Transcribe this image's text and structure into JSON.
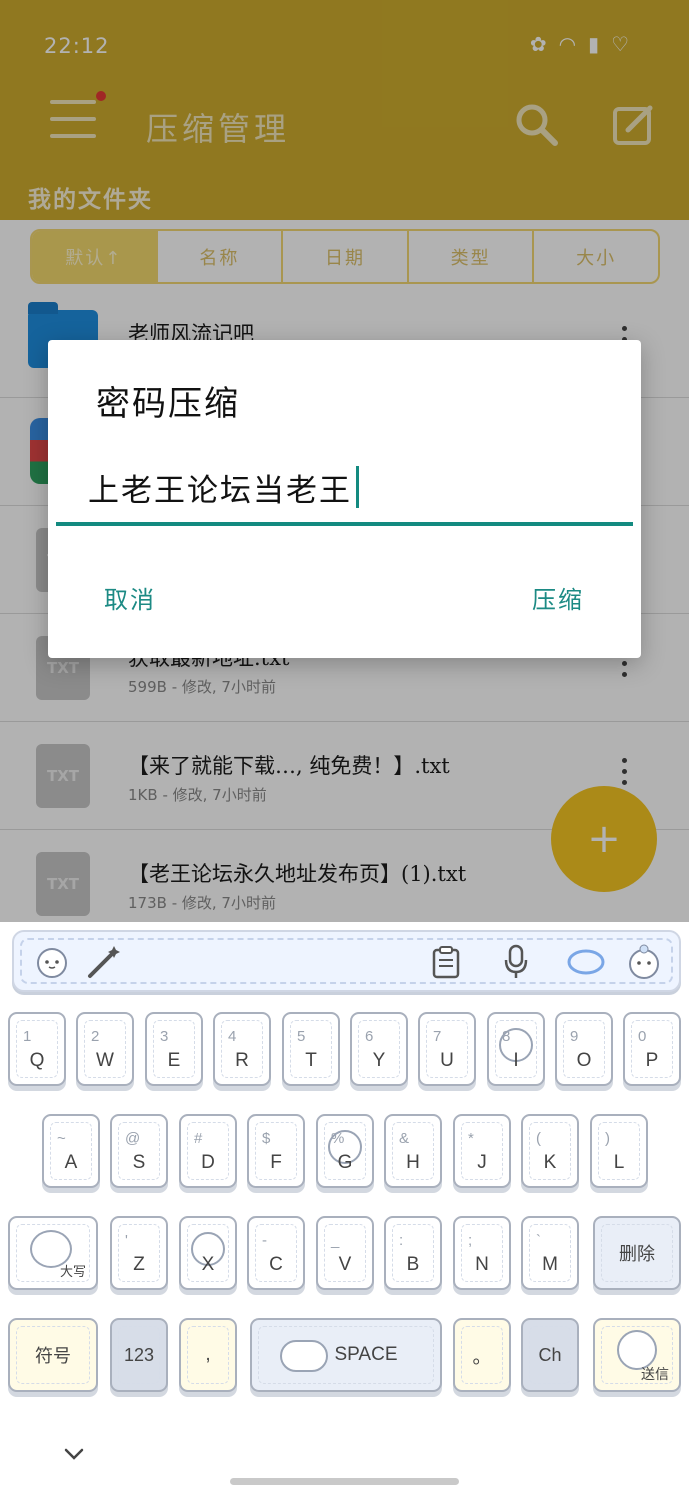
{
  "status_bar": {
    "time": "22:12"
  },
  "app": {
    "title": "压缩管理",
    "folder_label": "我的文件夹",
    "sort_tabs": [
      "默认↑",
      "名称",
      "日期",
      "类型",
      "大小"
    ],
    "files": [
      {
        "name": "老师风流记吧",
        "meta": "",
        "icon": "folder-icon"
      },
      {
        "name": "",
        "meta": "",
        "icon": "app-icon"
      },
      {
        "name": "",
        "meta": "",
        "icon": "txt-file-icon"
      },
      {
        "name": "获取最新地址.txt",
        "meta": "599B - 修改, 7小时前",
        "icon": "txt-file-icon"
      },
      {
        "name": "【来了就能下载…, 纯免费！】.txt",
        "meta": "1KB - 修改, 7小时前",
        "icon": "txt-file-icon"
      },
      {
        "name": "【老王论坛永久地址发布页】(1).txt",
        "meta": "173B - 修改, 7小时前",
        "icon": "txt-file-icon"
      }
    ],
    "file_type_label": "TXT",
    "fab_label": "+"
  },
  "dialog": {
    "title": "密码压缩",
    "input_value": "上老王论坛当老王",
    "cancel_label": "取消",
    "confirm_label": "压缩"
  },
  "keyboard": {
    "row1": [
      {
        "label": "Q",
        "sub": "1"
      },
      {
        "label": "W",
        "sub": "2"
      },
      {
        "label": "E",
        "sub": "3"
      },
      {
        "label": "R",
        "sub": "4"
      },
      {
        "label": "T",
        "sub": "5"
      },
      {
        "label": "Y",
        "sub": "6"
      },
      {
        "label": "U",
        "sub": "7"
      },
      {
        "label": "I",
        "sub": "8"
      },
      {
        "label": "O",
        "sub": "9"
      },
      {
        "label": "P",
        "sub": "0"
      }
    ],
    "row2": [
      {
        "label": "A",
        "sub": "~"
      },
      {
        "label": "S",
        "sub": "@"
      },
      {
        "label": "D",
        "sub": "#"
      },
      {
        "label": "F",
        "sub": "$"
      },
      {
        "label": "G",
        "sub": "%"
      },
      {
        "label": "H",
        "sub": "&"
      },
      {
        "label": "J",
        "sub": "*"
      },
      {
        "label": "K",
        "sub": "("
      },
      {
        "label": "L",
        "sub": ")"
      }
    ],
    "row3": [
      {
        "label": "Z",
        "sub": "'"
      },
      {
        "label": "X",
        "sub": ""
      },
      {
        "label": "C",
        "sub": "-"
      },
      {
        "label": "V",
        "sub": "_"
      },
      {
        "label": "B",
        "sub": ":"
      },
      {
        "label": "N",
        "sub": ";"
      },
      {
        "label": "M",
        "sub": "`"
      }
    ],
    "shift_label": "大写",
    "delete_label": "删除",
    "symbols_label": "符号",
    "numeric_label": "123",
    "comma_label": ",",
    "space_label": "SPACE",
    "period_label": "。",
    "lang_label": "Ch",
    "send_label": "送信"
  },
  "colors": {
    "app_bar": "#cfad2e",
    "accent": "#138a80",
    "fab": "#f5c623"
  }
}
